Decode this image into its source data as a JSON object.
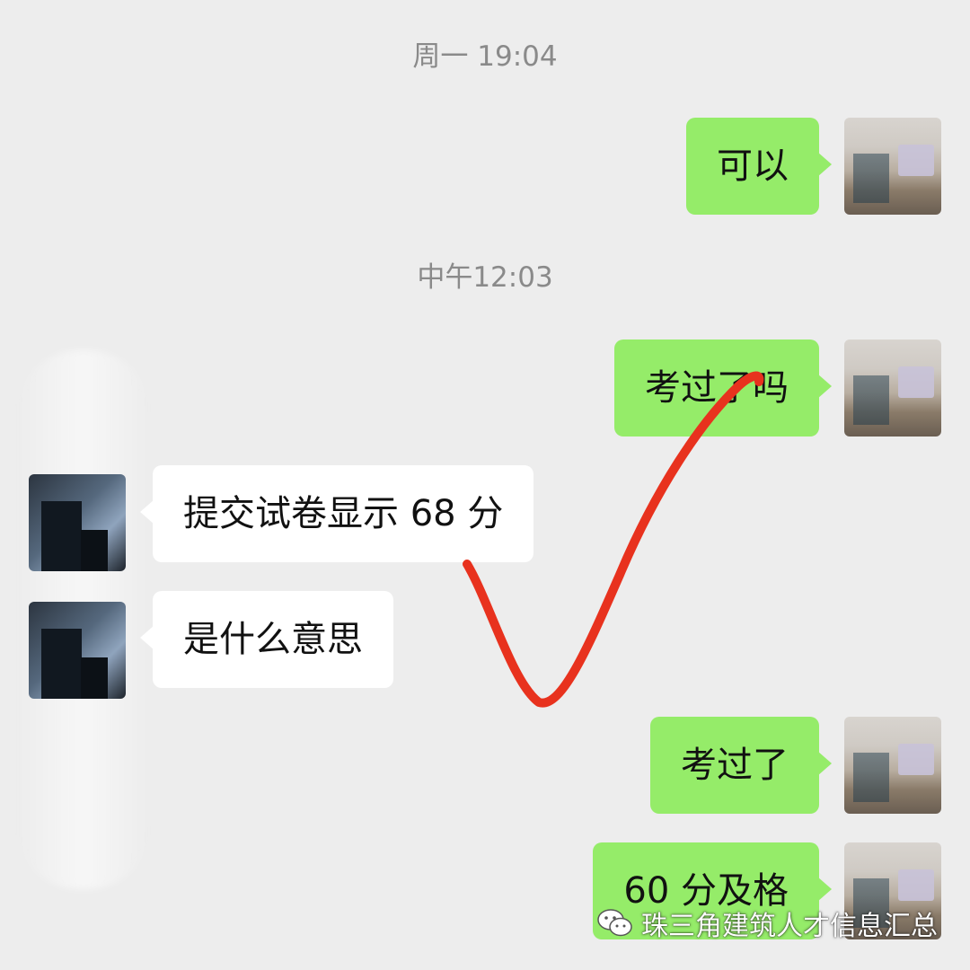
{
  "timestamps": [
    "周一 19:04",
    "中午12:03"
  ],
  "messages": [
    {
      "sender": "self",
      "text": "可以"
    },
    {
      "sender": "self",
      "text": "考过了吗"
    },
    {
      "sender": "peer",
      "text": "提交试卷显示 68 分"
    },
    {
      "sender": "peer",
      "text": "是什么意思"
    },
    {
      "sender": "self",
      "text": "考过了"
    },
    {
      "sender": "self",
      "text": "60 分及格"
    }
  ],
  "annotation": {
    "shape": "checkmark",
    "color": "#e8321e"
  },
  "watermark": {
    "text": "珠三角建筑人才信息汇总",
    "icon": "wechat-icon"
  },
  "colors": {
    "background": "#ededed",
    "self_bubble": "#95ec69",
    "peer_bubble": "#ffffff",
    "timestamp": "#8a8a8a"
  }
}
